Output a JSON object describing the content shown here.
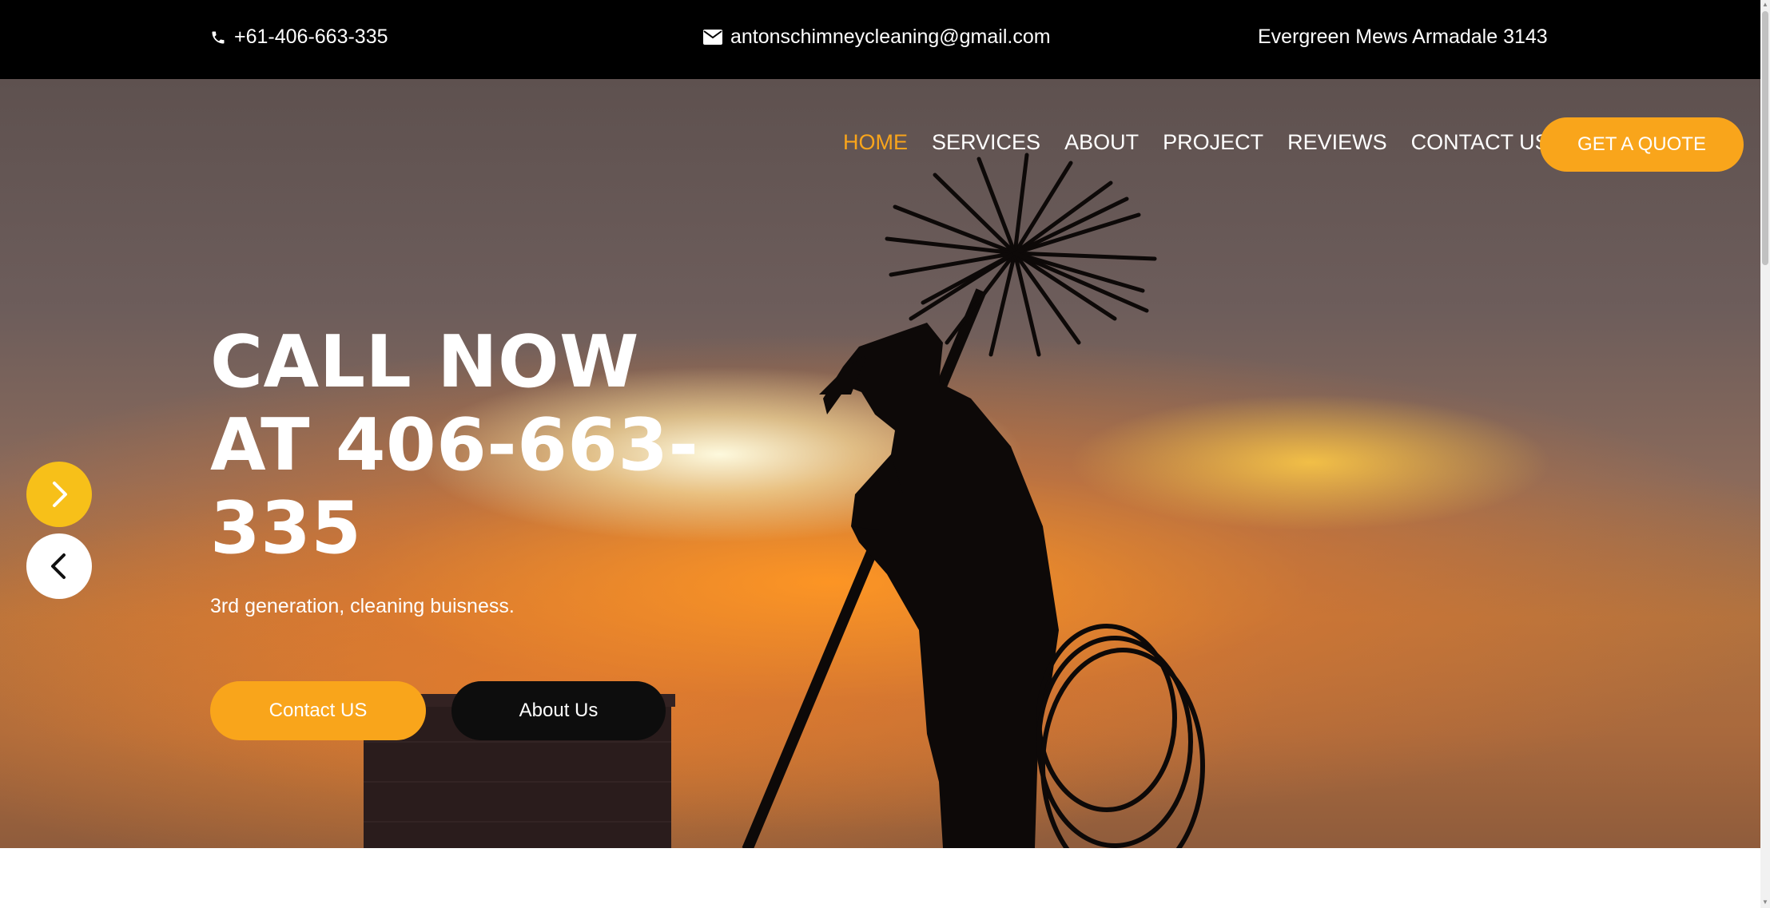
{
  "topbar": {
    "phone": "+61-406-663-335",
    "email": "antonschimneycleaning@gmail.com",
    "address": "Evergreen Mews Armadale 3143"
  },
  "nav": {
    "items": [
      "HOME",
      "SERVICES",
      "ABOUT",
      "PROJECT",
      "REVIEWS",
      "CONTACT US"
    ],
    "active": "HOME",
    "quote_label": "GET A QUOTE"
  },
  "hero": {
    "headline_line1": "CALL NOW",
    "headline_line2": "AT 406-663-",
    "headline_line3": "335",
    "tagline": "3rd generation, cleaning buisness.",
    "contact_label": "Contact US",
    "about_label": "About Us"
  },
  "icons": {
    "phone": "phone-icon",
    "email": "envelope-icon",
    "next": "chevron-right-icon",
    "prev": "chevron-left-icon"
  },
  "colors": {
    "accent": "#f9a51b",
    "slider_next": "#f7c019",
    "topbar_bg": "#000000",
    "dark_button": "#0d0d0d"
  }
}
